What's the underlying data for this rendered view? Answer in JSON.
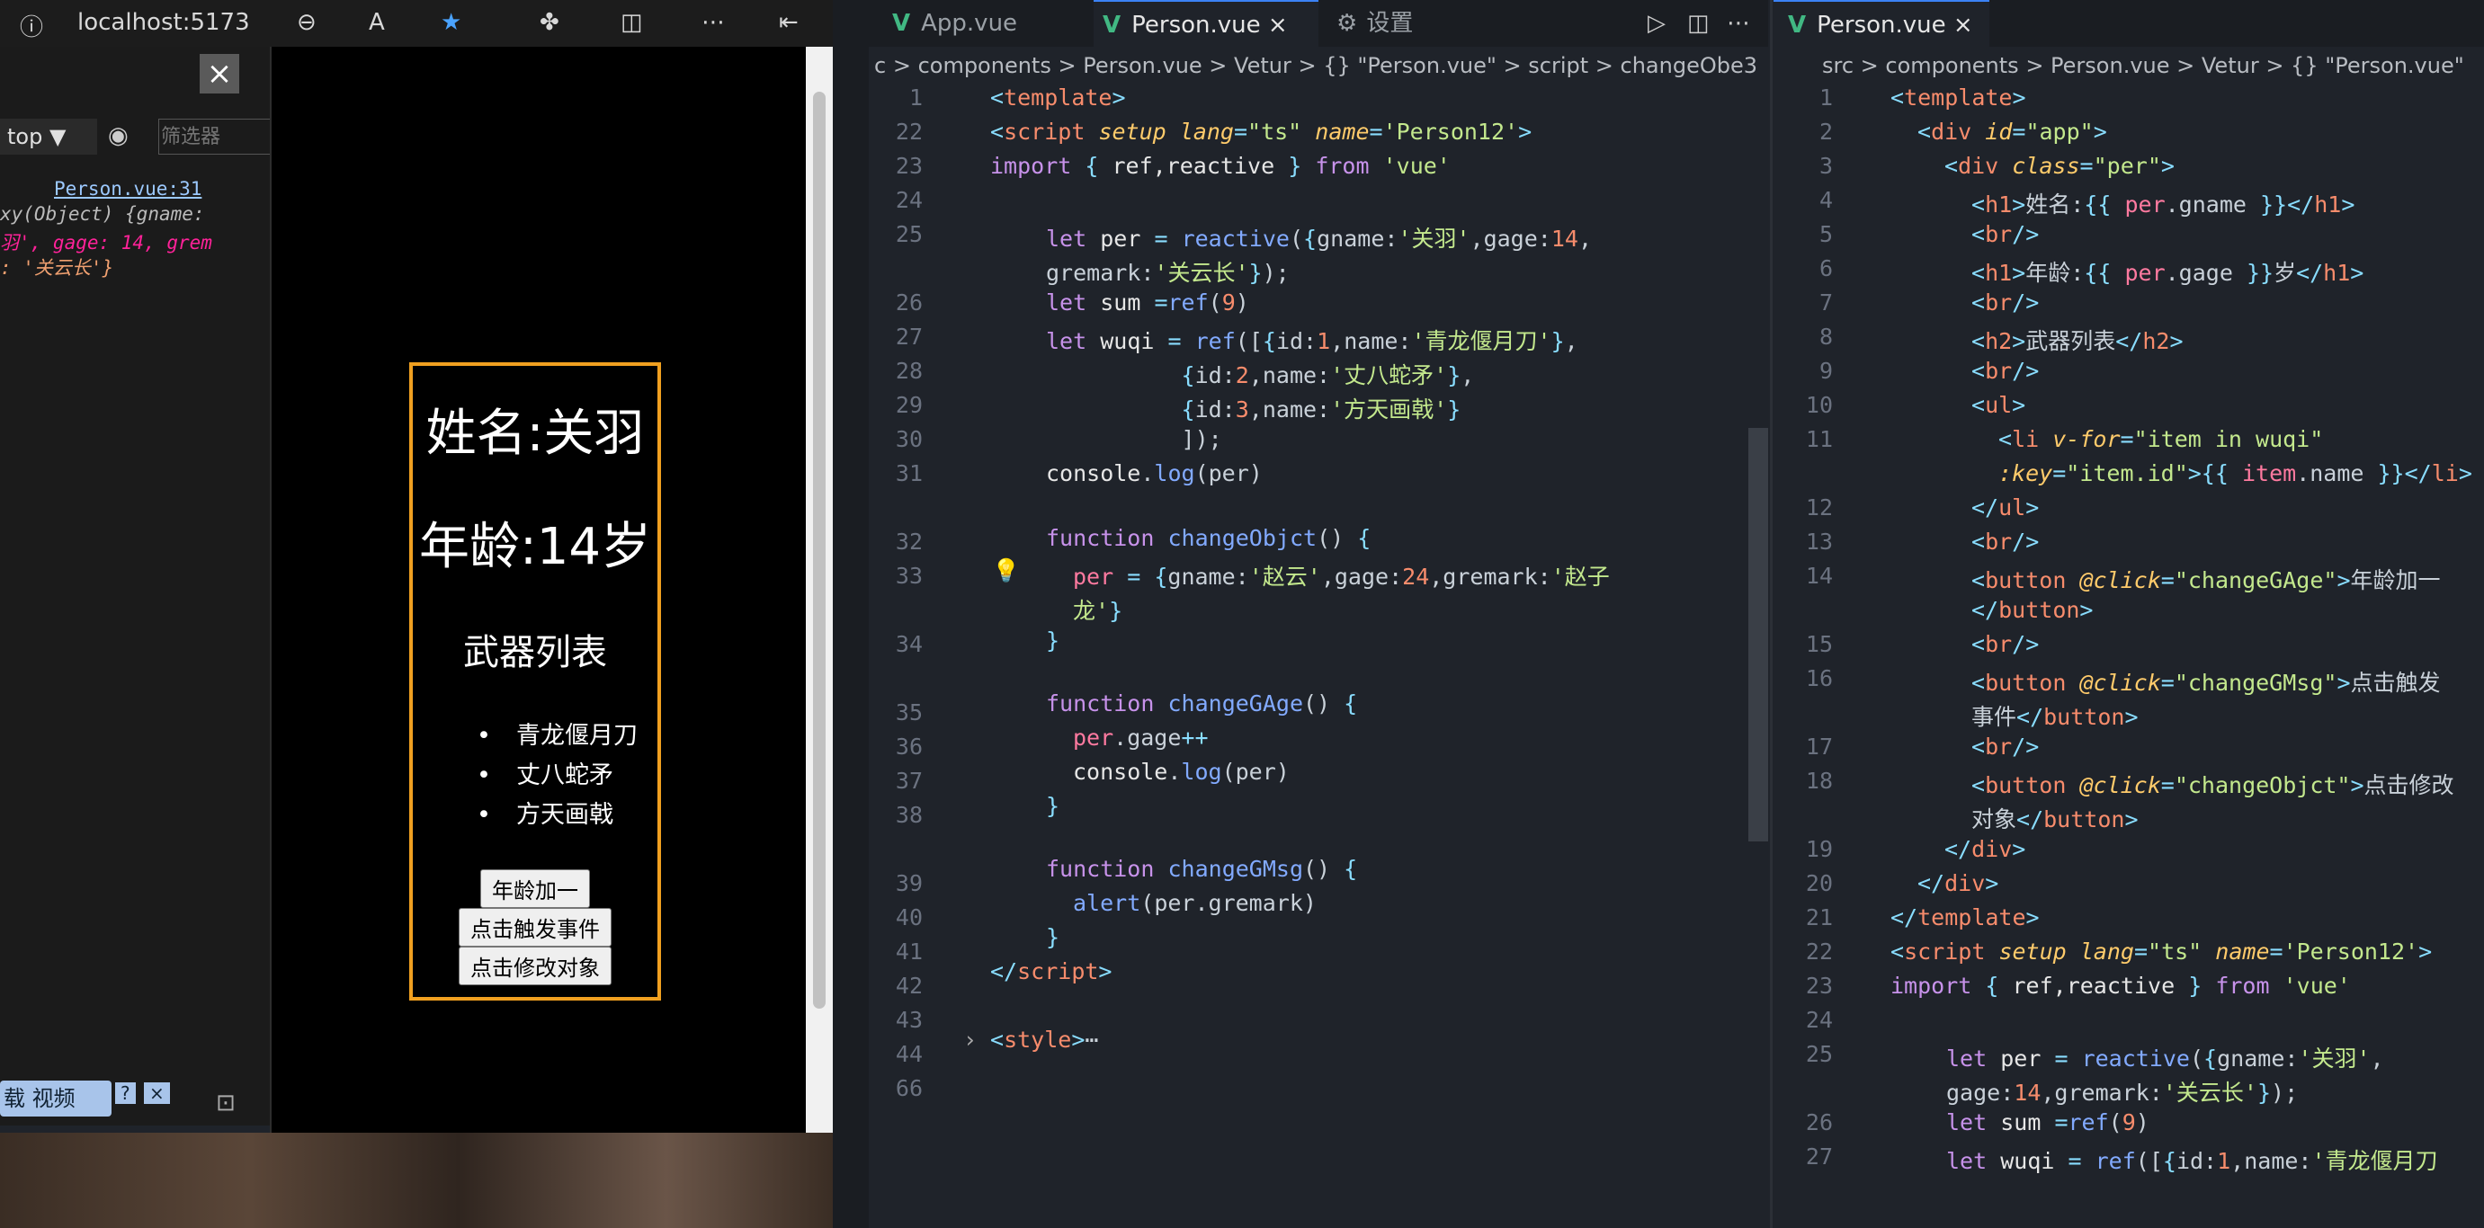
{
  "browser": {
    "address": "localhost:5173",
    "devtools": {
      "context": "top",
      "filter_placeholder": "筛选器",
      "console_source": "Person.vue:31",
      "console_line1": "xy(Object) {gname:",
      "console_line2": "羽', gage: 14, grem",
      "console_line3": ": '关云长'}",
      "video_label": "载 视频"
    },
    "page": {
      "name_heading": "姓名:关羽",
      "age_heading": "年龄:14岁",
      "weapons_heading": "武器列表",
      "weapons": [
        "青龙偃月刀",
        "丈八蛇矛",
        "方天画戟"
      ],
      "buttons": [
        "年龄加一",
        "点击触发事件",
        "点击修改对象"
      ]
    }
  },
  "editor": {
    "tabs_left": [
      "App.vue",
      "Person.vue",
      "设置"
    ],
    "tabs_right": [
      "Person.vue"
    ],
    "breadcrumb_left": "c > components > Person.vue > Vetur > {} \"Person.vue\" > script > changeObe3",
    "breadcrumb_right": "src > components > Person.vue > Vetur > {} \"Person.vue\"",
    "left_line_numbers": [
      "1",
      "22",
      "23",
      "24",
      "25",
      "",
      "26",
      "27",
      "28",
      "29",
      "30",
      "31",
      "",
      "32",
      "33",
      "",
      "34",
      "",
      "35",
      "36",
      "37",
      "38",
      "",
      "39",
      "40",
      "41",
      "42",
      "43",
      "44",
      "66"
    ],
    "right_line_numbers": [
      "1",
      "2",
      "3",
      "4",
      "5",
      "6",
      "7",
      "8",
      "9",
      "10",
      "11",
      "",
      "12",
      "13",
      "14",
      "",
      "15",
      "16",
      "",
      "17",
      "18",
      "",
      "19",
      "20",
      "21",
      "22",
      "23",
      "24",
      "25",
      "",
      "26",
      "27"
    ]
  },
  "colors": {
    "accent": "#f0a020",
    "vue": "#41b883"
  }
}
